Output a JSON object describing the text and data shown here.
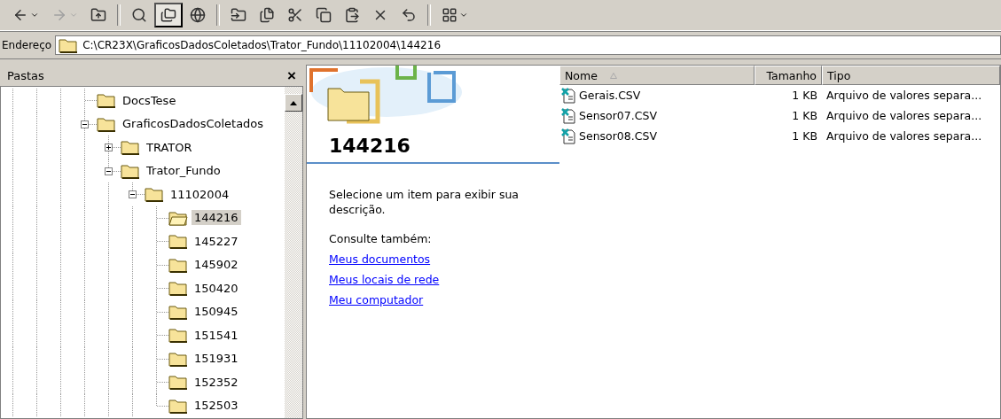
{
  "toolbar": [
    {
      "kind": "back",
      "disabled": false
    },
    {
      "kind": "forward",
      "disabled": true
    },
    {
      "kind": "up",
      "disabled": false
    },
    {
      "kind": "search",
      "selected": false
    },
    {
      "kind": "folders",
      "selected": true
    },
    {
      "kind": "history",
      "selected": false
    },
    {
      "kind": "move",
      "disabled": false
    },
    {
      "kind": "copy-to",
      "disabled": false
    },
    {
      "kind": "cut",
      "disabled": false
    },
    {
      "kind": "copy",
      "disabled": false
    },
    {
      "kind": "paste",
      "disabled": false
    },
    {
      "kind": "delete",
      "disabled": false
    },
    {
      "kind": "undo",
      "disabled": false
    },
    {
      "kind": "views",
      "disabled": false
    }
  ],
  "address": {
    "label": "Endereço",
    "value": "C:\\CR23X\\GraficosDadosColetados\\Trator_Fundo\\11102004\\144216"
  },
  "folders_pane": {
    "title": "Pastas",
    "close": "×",
    "tree": [
      {
        "label": "DocsTese",
        "selected": false
      },
      {
        "label": "GraficosDadosColetados",
        "selected": false,
        "expanded": true,
        "children": [
          {
            "label": "TRATOR",
            "selected": false,
            "expanded": false
          },
          {
            "label": "Trator_Fundo",
            "selected": false,
            "expanded": true,
            "children": [
              {
                "label": "11102004",
                "selected": false,
                "expanded": true,
                "children": [
                  {
                    "label": "144216",
                    "selected": true
                  },
                  {
                    "label": "145227",
                    "selected": false
                  },
                  {
                    "label": "145902",
                    "selected": false
                  },
                  {
                    "label": "150420",
                    "selected": false
                  },
                  {
                    "label": "150945",
                    "selected": false
                  },
                  {
                    "label": "151541",
                    "selected": false
                  },
                  {
                    "label": "151931",
                    "selected": false
                  },
                  {
                    "label": "152352",
                    "selected": false
                  },
                  {
                    "label": "152503",
                    "selected": false
                  }
                ]
              }
            ]
          }
        ]
      }
    ]
  },
  "info_panel": {
    "title": "144216",
    "description": "Selecione um item para exibir sua descrição.",
    "see_also": "Consulte também:",
    "links": [
      "Meus documentos",
      "Meus locais de rede",
      "Meu computador"
    ]
  },
  "file_list": {
    "columns": [
      {
        "label": "Nome",
        "sorted": true
      },
      {
        "label": "Tamanho",
        "sorted": false
      },
      {
        "label": "Tipo",
        "sorted": false
      }
    ],
    "rows": [
      {
        "name": "Gerais.CSV",
        "size": "1 KB",
        "type": "Arquivo de valores separa..."
      },
      {
        "name": "Sensor07.CSV",
        "size": "1 KB",
        "type": "Arquivo de valores separa..."
      },
      {
        "name": "Sensor08.CSV",
        "size": "1 KB",
        "type": "Arquivo de valores separa..."
      }
    ]
  }
}
